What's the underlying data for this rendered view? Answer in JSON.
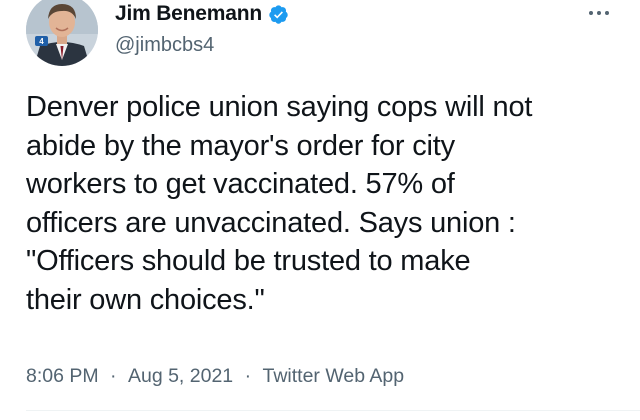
{
  "author": {
    "display_name": "Jim Benemann",
    "handle": "@jimbcbs4",
    "verified": true,
    "avatar_badge": "4",
    "verified_icon": "verified-badge-icon",
    "more_icon": "more-options-icon"
  },
  "tweet": {
    "text": "Denver police union saying cops will not\nabide by the mayor's order for city\nworkers to get vaccinated. 57% of\nofficers are unvaccinated. Says union :\n\"Officers should be trusted to make\ntheir own choices.\"",
    "time": "8:06 PM",
    "separator": "·",
    "date": "Aug 5, 2021",
    "source": "Twitter Web App"
  },
  "colors": {
    "text_primary": "#0f1419",
    "text_secondary": "#536471",
    "verified_blue": "#1d9bf0",
    "divider": "#eff3f4"
  }
}
